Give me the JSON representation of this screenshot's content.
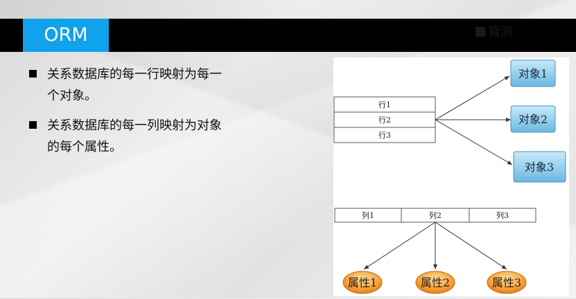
{
  "slide": {
    "title": "ORM",
    "logo_text": "盲​测"
  },
  "bullets": [
    {
      "line1": "关系数据库的每一行映射为每一",
      "line2": "个对象。"
    },
    {
      "line1": "关系数据库的每一列映射为对象",
      "line2": "的每个属性。"
    }
  ],
  "diagram": {
    "rows": [
      "行1",
      "行2",
      "行3"
    ],
    "objects": [
      "对象1",
      "对象2",
      "对象3"
    ],
    "columns": [
      "列1",
      "列2",
      "列3"
    ],
    "attributes": [
      "属性1",
      "属性2",
      "属性3"
    ],
    "colors": {
      "object_fill_top": "#b7e1f7",
      "object_fill_bottom": "#6bb8e0",
      "attr_fill_top": "#fbd38a",
      "attr_fill_bottom": "#f08a1c"
    }
  }
}
